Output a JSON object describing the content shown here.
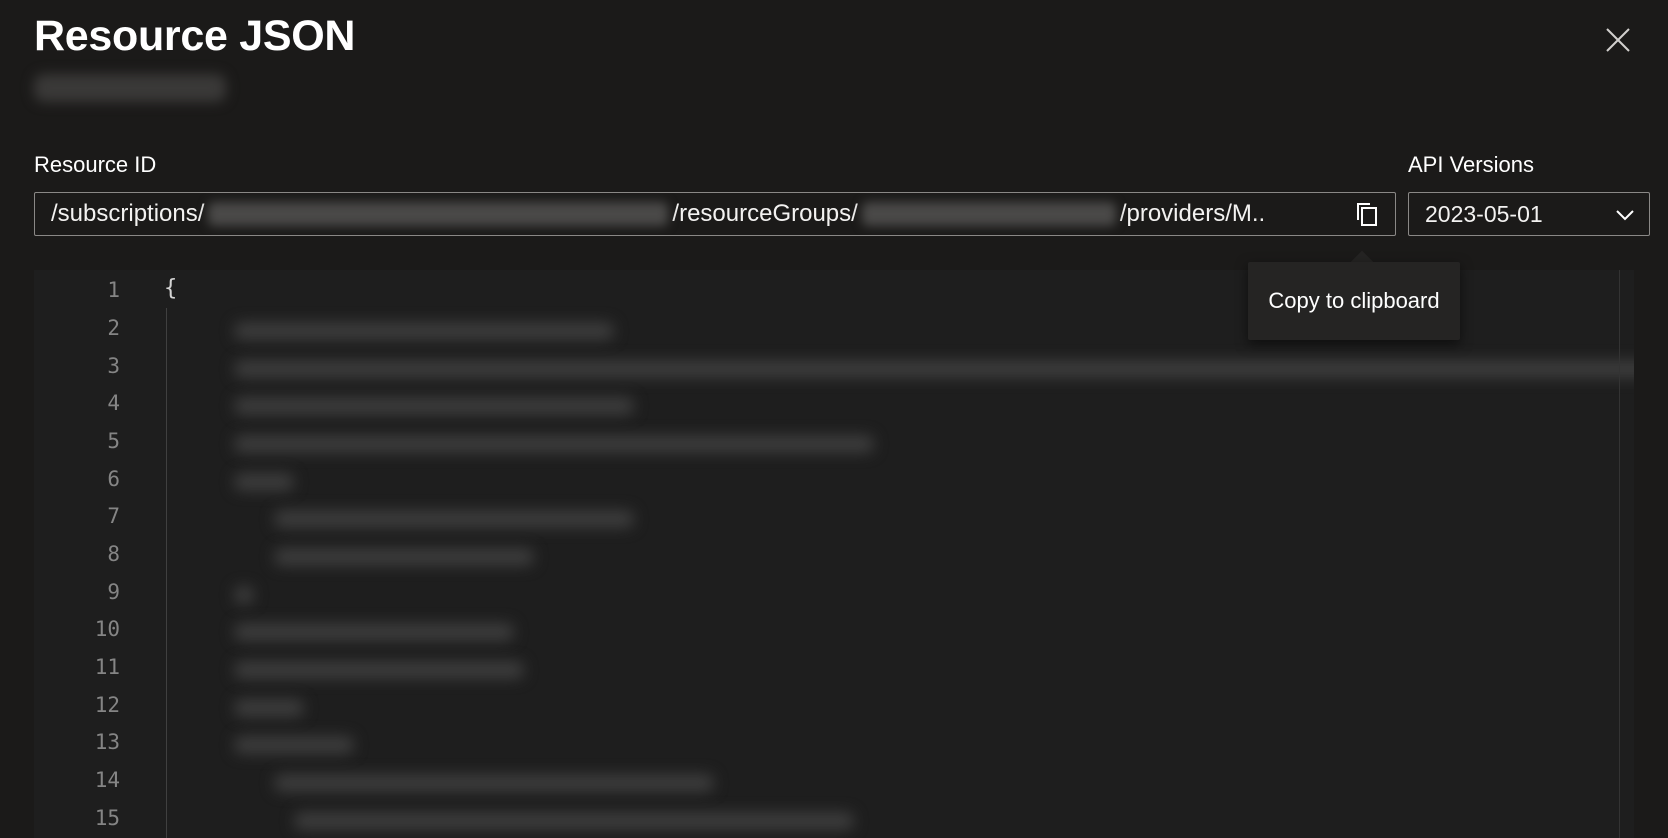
{
  "dialog": {
    "title": "Resource JSON"
  },
  "resource_id": {
    "label": "Resource ID",
    "segments": [
      "/subscriptions/",
      "/resourceGroups/",
      "/providers/M.."
    ],
    "copy_tooltip": "Copy to clipboard"
  },
  "api_versions": {
    "label": "API Versions",
    "selected": "2023-05-01"
  },
  "editor": {
    "first_line": "{",
    "line_numbers": [
      "1",
      "2",
      "3",
      "4",
      "5",
      "6",
      "7",
      "8",
      "9",
      "10",
      "11",
      "12",
      "13",
      "14",
      "15"
    ]
  },
  "icons": {
    "close": "close-icon",
    "copy": "copy-icon",
    "dropdown": "chevron-down-icon"
  },
  "colors": {
    "background": "#1b1a19",
    "editor_background": "#1e1e1e",
    "border": "#8a8886",
    "line_number": "#858585"
  }
}
